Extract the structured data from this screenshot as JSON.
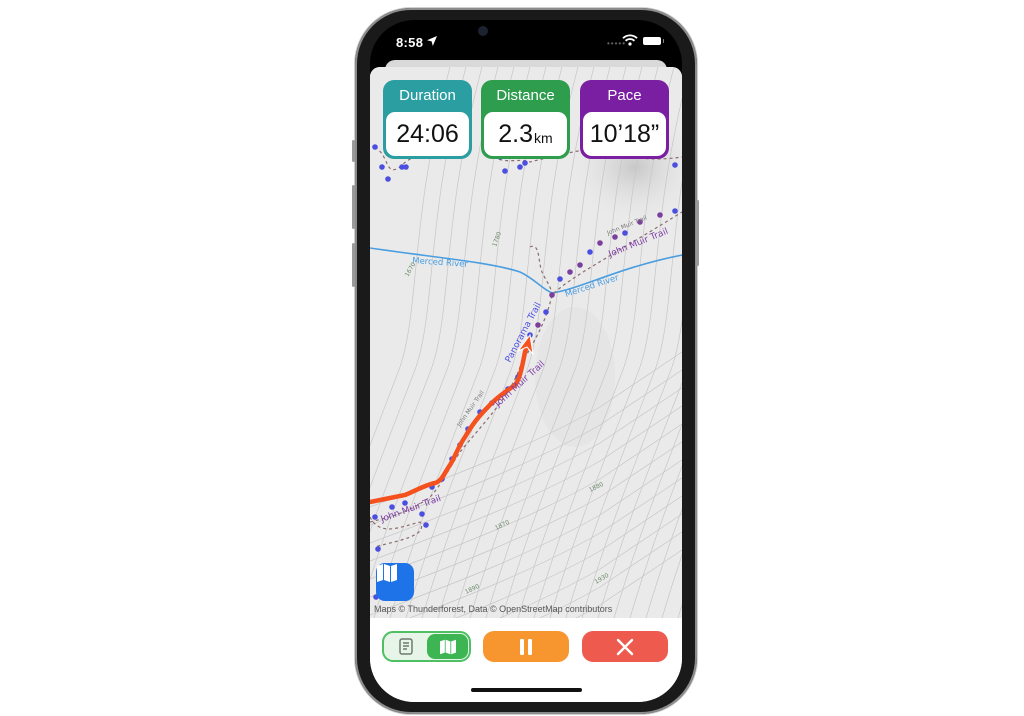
{
  "status_bar": {
    "time": "8:58",
    "location_icon": "location-arrow-icon",
    "signal_icon": "cellular-dots-icon",
    "wifi_icon": "wifi-icon",
    "battery_icon": "battery-icon"
  },
  "stats": [
    {
      "label": "Duration",
      "value": "24:06",
      "unit": "",
      "color": "#2a9ea1"
    },
    {
      "label": "Distance",
      "value": "2.3",
      "unit": "km",
      "color": "#2f9d4e"
    },
    {
      "label": "Pace",
      "value": "10’18”",
      "unit": "",
      "color": "#7b1fa2"
    }
  ],
  "map": {
    "labels": {
      "merced_river_1": "Merced River",
      "merced_river_2": "Merced River",
      "john_muir_1": "John Muir Trail",
      "john_muir_2": "John Muir Trail",
      "john_muir_3": "John Muir Trail",
      "john_muir_small_1": "John Muir Trail",
      "john_muir_small_2": "John Muir Trail",
      "panorama": "Panorama Trail",
      "contour_1780": "1780",
      "contour_1670": "1670",
      "contour_1880": "1880",
      "contour_1870": "1870",
      "contour_1890": "1890",
      "contour_1930": "1930"
    },
    "attribution": "Maps © Thunderforest, Data © OpenStreetMap contributors",
    "colors": {
      "track": "#f4511e",
      "river": "#4a9ee0",
      "trail_label": "#7e3fa8",
      "waypoint_blue": "#4b4fe0",
      "waypoint_purple": "#7b3f9e"
    }
  },
  "bottom_bar": {
    "view_toggle": {
      "options": [
        "summary",
        "map"
      ],
      "selected": "map"
    },
    "pause_icon": "pause-icon",
    "stop_icon": "close-icon",
    "colors": {
      "pause": "#f7952f",
      "stop": "#ef5a4f",
      "toggle": "#3db553"
    }
  }
}
